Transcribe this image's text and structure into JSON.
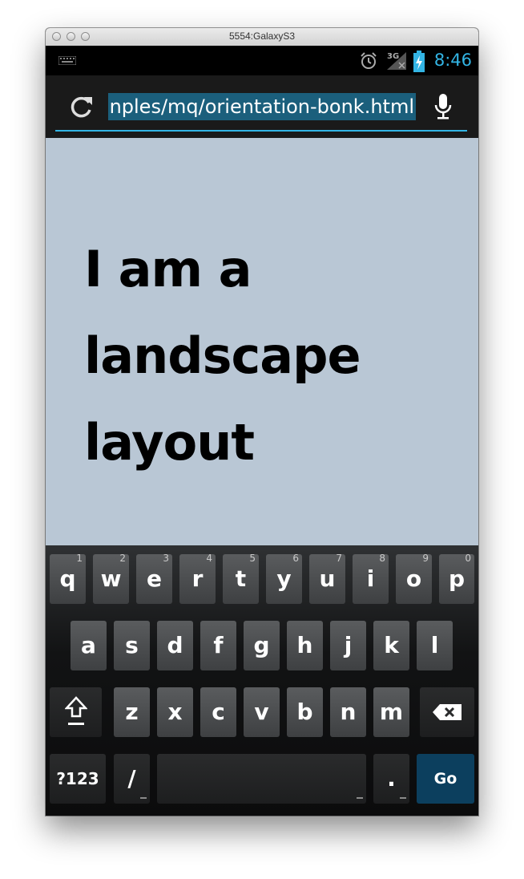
{
  "window": {
    "title": "5554:GalaxyS3"
  },
  "status_bar": {
    "time": "8:46",
    "network": "3G",
    "icons": [
      "keyboard-notification-icon",
      "alarm-icon",
      "signal-icon",
      "battery-charging-icon"
    ]
  },
  "url_bar": {
    "url_visible": "nples/mq/orientation-bonk.html",
    "icons": [
      "reload-icon",
      "microphone-icon"
    ]
  },
  "page": {
    "headline_lines": [
      "I am a",
      "landscape",
      "layout"
    ]
  },
  "keyboard": {
    "row1": [
      {
        "key": "q",
        "hint": "1"
      },
      {
        "key": "w",
        "hint": "2"
      },
      {
        "key": "e",
        "hint": "3"
      },
      {
        "key": "r",
        "hint": "4"
      },
      {
        "key": "t",
        "hint": "5"
      },
      {
        "key": "y",
        "hint": "6"
      },
      {
        "key": "u",
        "hint": "7"
      },
      {
        "key": "i",
        "hint": "8"
      },
      {
        "key": "o",
        "hint": "9"
      },
      {
        "key": "p",
        "hint": "0"
      }
    ],
    "row2": [
      "a",
      "s",
      "d",
      "f",
      "g",
      "h",
      "j",
      "k",
      "l"
    ],
    "row3": [
      "z",
      "x",
      "c",
      "v",
      "b",
      "n",
      "m"
    ],
    "row4": {
      "symbols": "?123",
      "slash": "/",
      "period": ".",
      "go": "Go"
    },
    "special_icons": [
      "shift-icon",
      "backspace-icon"
    ]
  },
  "colors": {
    "accent": "#33b5e5",
    "url_selection": "#1b5f7c",
    "page_background": "#b9c7d5",
    "go_key": "#0c3f5e"
  }
}
